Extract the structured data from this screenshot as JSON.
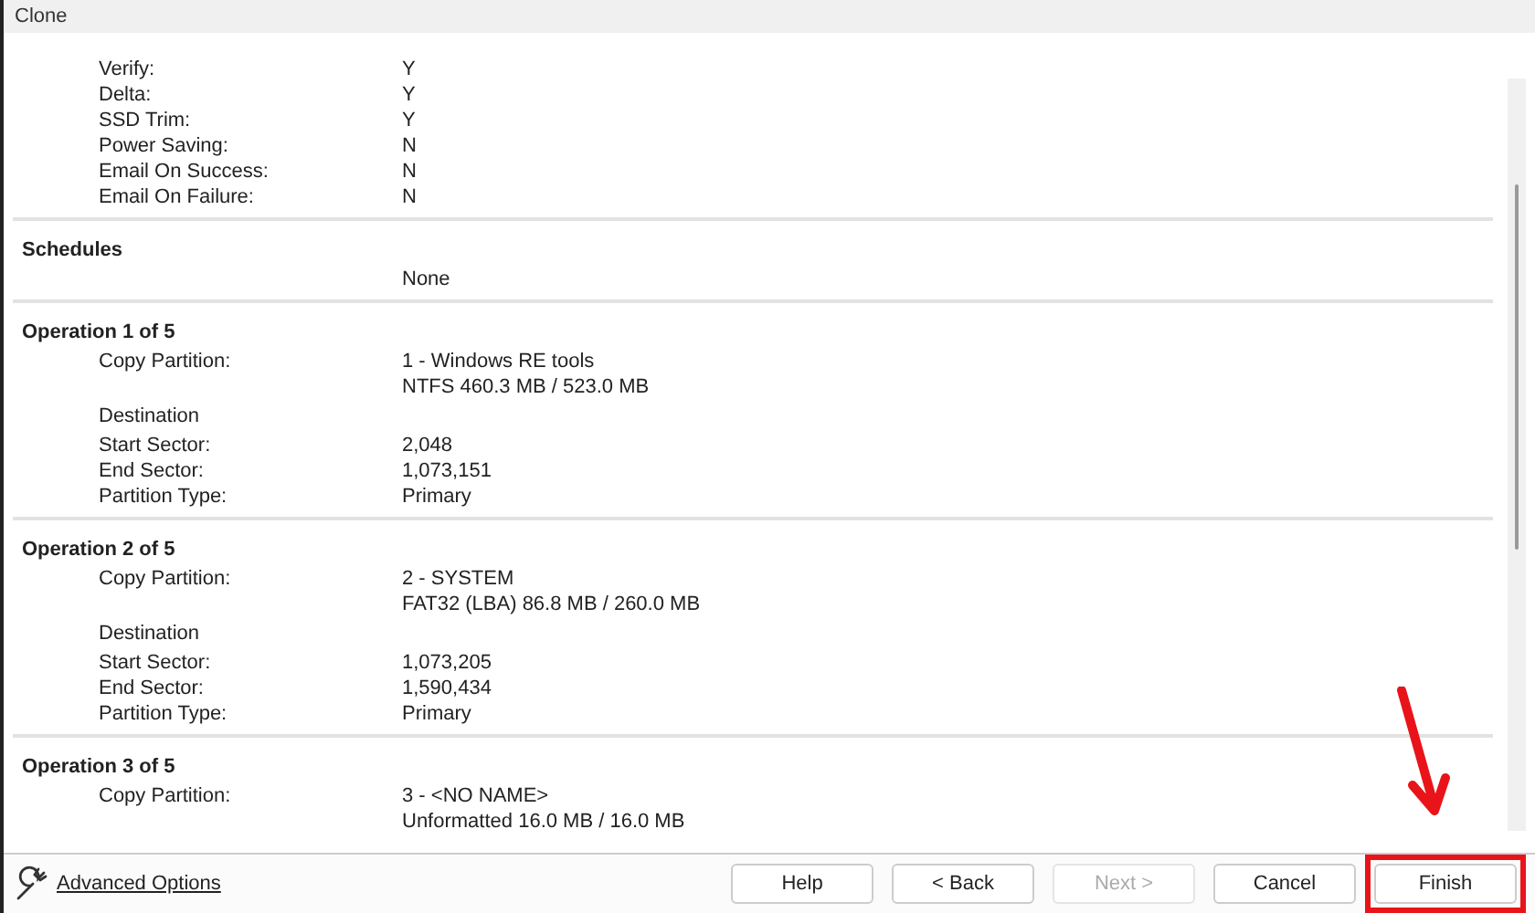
{
  "window": {
    "title": "Clone"
  },
  "sections": [
    {
      "rows": [
        {
          "label": "Verify:",
          "values": [
            "Y"
          ]
        },
        {
          "label": "Delta:",
          "values": [
            "Y"
          ]
        },
        {
          "label": "SSD Trim:",
          "values": [
            "Y"
          ]
        },
        {
          "label": "Power Saving:",
          "values": [
            "N"
          ]
        },
        {
          "label": "Email On Success:",
          "values": [
            "N"
          ]
        },
        {
          "label": "Email On Failure:",
          "values": [
            "N"
          ]
        }
      ]
    },
    {
      "heading": "Schedules",
      "rows": [
        {
          "values": [
            "None"
          ]
        }
      ]
    },
    {
      "heading": "Operation 1 of 5",
      "rows": [
        {
          "label": "Copy Partition:",
          "values": [
            "1 - Windows RE tools",
            "NTFS 460.3 MB / 523.0 MB"
          ]
        },
        {
          "label": "Destination"
        },
        {
          "label": "Start Sector:",
          "values": [
            "2,048"
          ]
        },
        {
          "label": "End Sector:",
          "values": [
            "1,073,151"
          ]
        },
        {
          "label": "Partition Type:",
          "values": [
            "Primary"
          ]
        }
      ]
    },
    {
      "heading": "Operation 2 of 5",
      "rows": [
        {
          "label": "Copy Partition:",
          "values": [
            "2 - SYSTEM",
            "FAT32 (LBA) 86.8 MB / 260.0 MB"
          ]
        },
        {
          "label": "Destination"
        },
        {
          "label": "Start Sector:",
          "values": [
            "1,073,205"
          ]
        },
        {
          "label": "End Sector:",
          "values": [
            "1,590,434"
          ]
        },
        {
          "label": "Partition Type:",
          "values": [
            "Primary"
          ]
        }
      ]
    },
    {
      "heading": "Operation 3 of 5",
      "rows": [
        {
          "label": "Copy Partition:",
          "values": [
            "3 - <NO NAME>",
            "Unformatted 16.0 MB / 16.0 MB"
          ]
        }
      ]
    }
  ],
  "footer": {
    "link": "Advanced Options",
    "buttons": [
      {
        "label": "Help",
        "disabled": false,
        "highlighted": false
      },
      {
        "label": "< Back",
        "disabled": false,
        "highlighted": false
      },
      {
        "label": "Next >",
        "disabled": true,
        "highlighted": false
      },
      {
        "label": "Cancel",
        "disabled": false,
        "highlighted": false
      },
      {
        "label": "Finish",
        "disabled": false,
        "highlighted": true
      }
    ]
  }
}
